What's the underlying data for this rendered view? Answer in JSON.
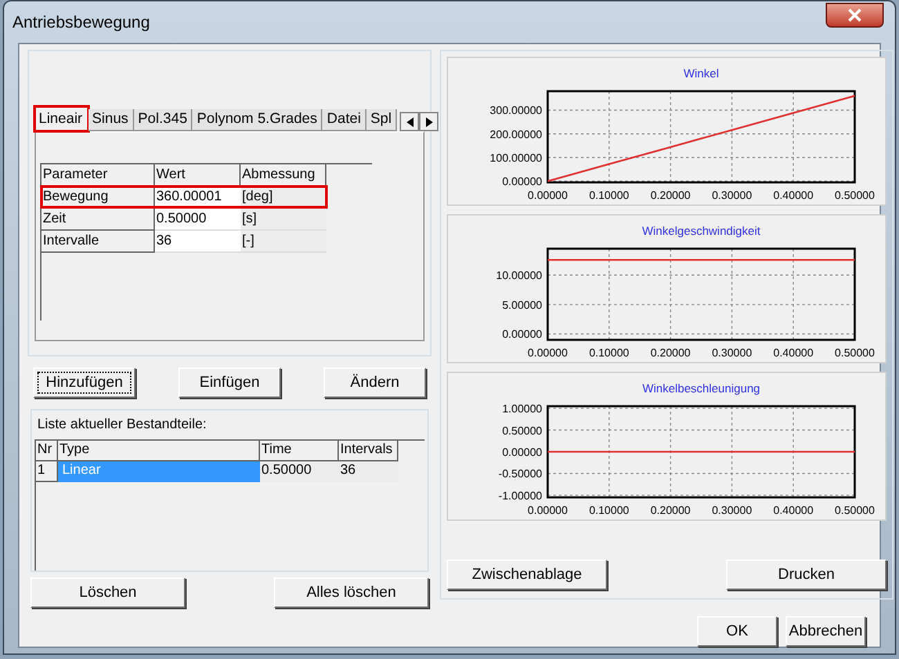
{
  "window": {
    "title": "Antriebsbewegung"
  },
  "tabs": [
    {
      "label": "Lineair",
      "selected": true,
      "highlighted": true
    },
    {
      "label": "Sinus",
      "selected": false,
      "highlighted": false
    },
    {
      "label": "Pol.345",
      "selected": false,
      "highlighted": false
    },
    {
      "label": "Polynom 5.Grades",
      "selected": false,
      "highlighted": false
    },
    {
      "label": "Datei",
      "selected": false,
      "highlighted": false
    },
    {
      "label": "Spl",
      "selected": false,
      "highlighted": false
    }
  ],
  "parameters": {
    "columns": [
      "Parameter",
      "Wert",
      "Abmessung"
    ],
    "rows": [
      {
        "name": "Bewegung",
        "value": "360.00001",
        "unit": "[deg]",
        "highlighted": true
      },
      {
        "name": "Zeit",
        "value": "0.50000",
        "unit": "[s]",
        "highlighted": false
      },
      {
        "name": "Intervalle",
        "value": "36",
        "unit": "[-]",
        "highlighted": false
      }
    ]
  },
  "edit_buttons": [
    "Hinzufügen",
    "Einfügen",
    "Ändern"
  ],
  "components": {
    "title": "Liste aktueller Bestandteile:",
    "columns": [
      "Nr",
      "Type",
      "Time",
      "Intervals"
    ],
    "rows": [
      {
        "nr": "1",
        "type": "Linear",
        "time": "0.50000",
        "intervals": "36",
        "selected": true
      }
    ]
  },
  "list_buttons": [
    "Löschen",
    "Alles löschen"
  ],
  "charts": [
    {
      "chart_data": {
        "type": "line",
        "title": "Winkel",
        "x": [
          0,
          0.1,
          0.2,
          0.3,
          0.4,
          0.5
        ],
        "grid": true,
        "series": [
          {
            "color": "#e03030",
            "values": [
              0,
              72,
              144,
              216,
              288,
              360
            ]
          }
        ],
        "xlim": [
          0,
          0.5
        ],
        "ylim": [
          -5,
          380
        ],
        "xticks": [
          {
            "value": 0,
            "label": "0.00000"
          },
          {
            "value": 0.1,
            "label": "0.10000"
          },
          {
            "value": 0.2,
            "label": "0.20000"
          },
          {
            "value": 0.3,
            "label": "0.30000"
          },
          {
            "value": 0.4,
            "label": "0.40000"
          },
          {
            "value": 0.5,
            "label": "0.50000"
          }
        ],
        "yticks": [
          {
            "value": 0,
            "label": "0.00000"
          },
          {
            "value": 100,
            "label": "100.00000"
          },
          {
            "value": 200,
            "label": "200.00000"
          },
          {
            "value": 300,
            "label": "300.00000"
          }
        ]
      }
    },
    {
      "chart_data": {
        "type": "line",
        "title": "Winkelgeschwindigkeit",
        "x": [
          0,
          0.1,
          0.2,
          0.3,
          0.4,
          0.5
        ],
        "grid": true,
        "series": [
          {
            "color": "#e03030",
            "values": [
              12.6,
              12.6,
              12.6,
              12.6,
              12.6,
              12.6
            ]
          }
        ],
        "xlim": [
          0,
          0.5
        ],
        "ylim": [
          -1,
          14.5
        ],
        "xticks": [
          {
            "value": 0,
            "label": "0.00000"
          },
          {
            "value": 0.1,
            "label": "0.10000"
          },
          {
            "value": 0.2,
            "label": "0.20000"
          },
          {
            "value": 0.3,
            "label": "0.30000"
          },
          {
            "value": 0.4,
            "label": "0.40000"
          },
          {
            "value": 0.5,
            "label": "0.50000"
          }
        ],
        "yticks": [
          {
            "value": 0,
            "label": "0.00000"
          },
          {
            "value": 5,
            "label": "5.00000"
          },
          {
            "value": 10,
            "label": "10.00000"
          }
        ]
      }
    },
    {
      "chart_data": {
        "type": "line",
        "title": "Winkelbeschleunigung",
        "x": [
          0,
          0.1,
          0.2,
          0.3,
          0.4,
          0.5
        ],
        "grid": true,
        "series": [
          {
            "color": "#e03030",
            "values": [
              0,
              0,
              0,
              0,
              0,
              0
            ]
          }
        ],
        "xlim": [
          0,
          0.5
        ],
        "ylim": [
          -1.05,
          1.05
        ],
        "xticks": [
          {
            "value": 0,
            "label": "0.00000"
          },
          {
            "value": 0.1,
            "label": "0.10000"
          },
          {
            "value": 0.2,
            "label": "0.20000"
          },
          {
            "value": 0.3,
            "label": "0.30000"
          },
          {
            "value": 0.4,
            "label": "0.40000"
          },
          {
            "value": 0.5,
            "label": "0.50000"
          }
        ],
        "yticks": [
          {
            "value": -1,
            "label": "-1.00000"
          },
          {
            "value": -0.5,
            "label": "-0.50000"
          },
          {
            "value": 0,
            "label": "0.00000"
          },
          {
            "value": 0.5,
            "label": "0.50000"
          },
          {
            "value": 1,
            "label": "1.00000"
          }
        ]
      }
    }
  ],
  "chart_buttons": [
    "Zwischenablage",
    "Drucken"
  ],
  "dialog_buttons": [
    "OK",
    "Abbrechen"
  ]
}
